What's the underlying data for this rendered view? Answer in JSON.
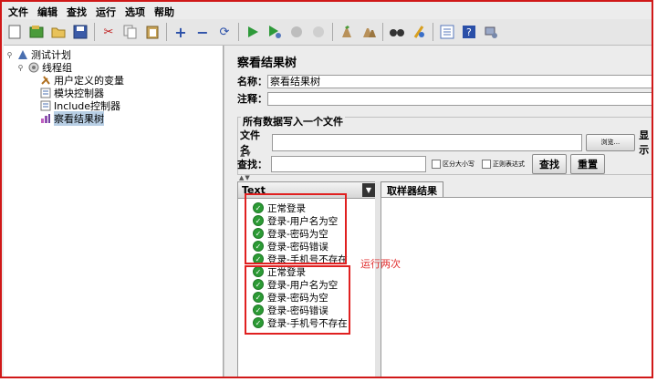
{
  "menu": [
    "文件",
    "编辑",
    "查找",
    "运行",
    "选项",
    "帮助"
  ],
  "toolbar_icons": [
    "new-icon",
    "template-icon",
    "open-icon",
    "save-icon",
    "cut-icon",
    "copy-icon",
    "paste-icon",
    "expand-icon",
    "collapse-icon",
    "toggle-icon",
    "start-icon",
    "start-no-pause-icon",
    "stop-icon",
    "shutdown-icon",
    "clear-icon",
    "clear-all-icon",
    "search-icon",
    "reset-search-icon",
    "function-helper-icon",
    "help-icon",
    "remote-icon"
  ],
  "tree": {
    "root": "测试计划",
    "thread_group": "线程组",
    "children": [
      "用户定义的变量",
      "模块控制器",
      "Include控制器",
      "察看结果树"
    ]
  },
  "panel": {
    "title": "察看结果树",
    "name_label": "名称：",
    "name_value": "察看结果树",
    "comment_label": "注释：",
    "comment_value": "",
    "write_all_label": "所有数据写入一个文件",
    "filename_label": "文件名",
    "filename_value": "",
    "browse_label": "浏览...",
    "display_label": "显示"
  },
  "search": {
    "label": "查找：",
    "value": "",
    "case_sensitive": "区分大小写",
    "regex": "正则表达式",
    "find_button": "查找",
    "reset_button": "重置"
  },
  "results": {
    "column_header": "Text",
    "tab_label": "取样器结果",
    "items": [
      "正常登录",
      "登录-用户名为空",
      "登录-密码为空",
      "登录-密码错误",
      "登录-手机号不存在",
      "正常登录",
      "登录-用户名为空",
      "登录-密码为空",
      "登录-密码错误",
      "登录-手机号不存在"
    ]
  },
  "annotation": "运行两次"
}
